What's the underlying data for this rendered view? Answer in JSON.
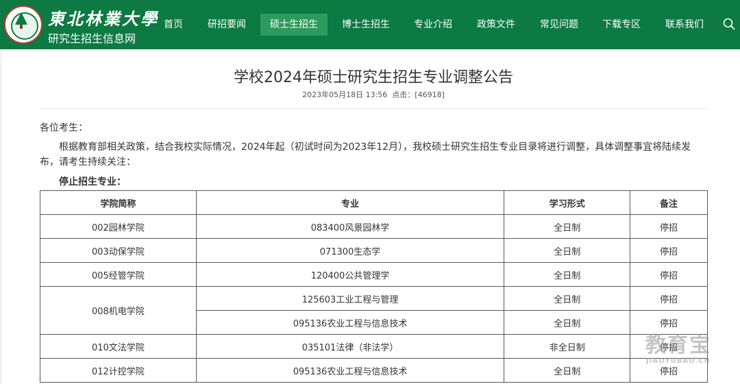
{
  "header": {
    "brand_title": "東北林業大學",
    "brand_subtitle": "研究生招生信息网",
    "nav": [
      {
        "label": "首页"
      },
      {
        "label": "研招要闻"
      },
      {
        "label": "硕士生招生",
        "active": true
      },
      {
        "label": "博士生招生"
      },
      {
        "label": "专业介绍"
      },
      {
        "label": "政策文件"
      },
      {
        "label": "常见问题"
      },
      {
        "label": "下载专区"
      },
      {
        "label": "联系我们"
      }
    ],
    "search_icon": "search-icon",
    "colors": {
      "background": "#0c7a42",
      "active_nav": "#2e9a5c"
    }
  },
  "article": {
    "title": "学校2024年硕士研究生招生专业调整公告",
    "meta": {
      "date": "2023年05月18日 13:56",
      "clicks_label": "点击：",
      "clicks": "[46918]"
    },
    "salutation": "各位考生：",
    "body": "根据教育部相关政策，结合我校实际情况，2024年起（初试时间为2023年12月），我校硕士研究生招生专业目录将进行调整，具体调整事宜将陆续发布，请考生持续关注：",
    "section_heading": "停止招生专业："
  },
  "table": {
    "headers": [
      "学院简称",
      "专业",
      "学习形式",
      "备注"
    ],
    "rows": [
      {
        "college": "002园林学院",
        "major": "083400风景园林学",
        "mode": "全日制",
        "note": "停招"
      },
      {
        "college": "003动保学院",
        "major": "071300生态学",
        "mode": "全日制",
        "note": "停招"
      },
      {
        "college": "005经管学院",
        "major": "120400公共管理学",
        "mode": "全日制",
        "note": "停招"
      },
      {
        "college": "008机电学院",
        "major": "125603工业工程与管理",
        "mode": "全日制",
        "note": "停招"
      },
      {
        "college": "",
        "major": "095136农业工程与信息技术",
        "mode": "全日制",
        "note": "停招"
      },
      {
        "college": "010文法学院",
        "major": "035101法律（非法学）",
        "mode": "非全日制",
        "note": "停招"
      },
      {
        "college": "012计控学院",
        "major": "095136农业工程与信息技术",
        "mode": "全日制",
        "note": "停招"
      }
    ]
  },
  "watermark": {
    "main": "教育宝",
    "sub": "JIAOYUBAO.CN"
  }
}
